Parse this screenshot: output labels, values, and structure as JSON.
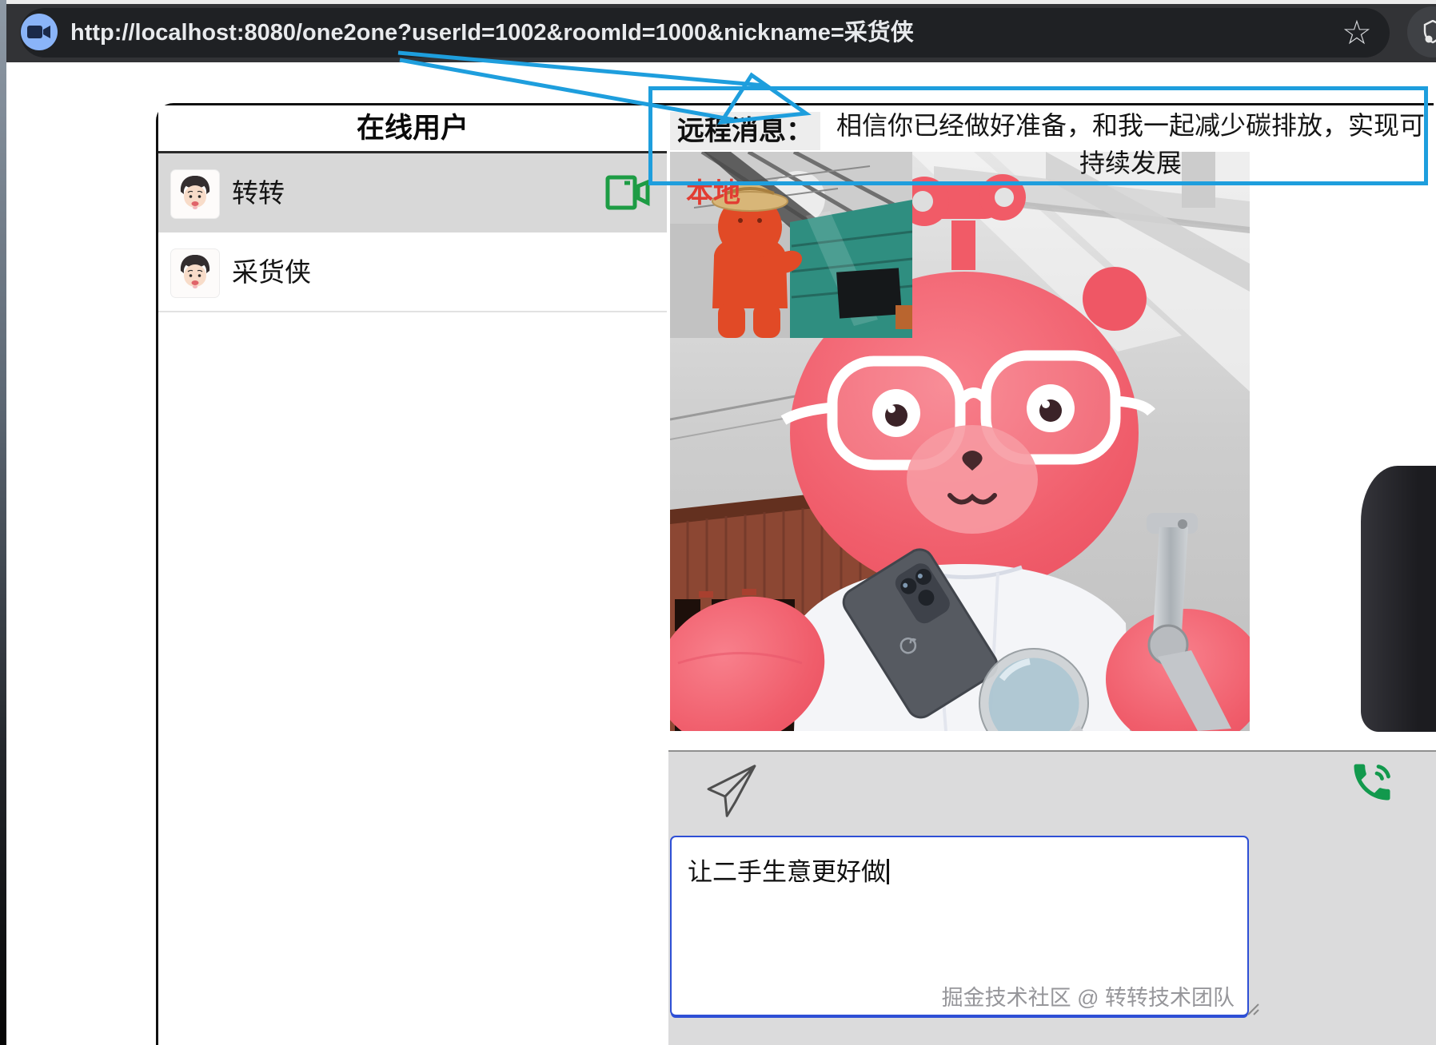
{
  "browser": {
    "url": "http://localhost:8080/one2one?userId=1002&roomId=1000&nickname=采货侠",
    "icons": {
      "camera_indicator": "video-camera-in-use",
      "bookmark": "star",
      "profile": "profile-circle"
    },
    "bookmark_glyph": "☆"
  },
  "online_users": {
    "title": "在线用户",
    "users": [
      {
        "name": "转转",
        "selected": true,
        "in_call": true
      },
      {
        "name": "采货侠",
        "selected": false,
        "in_call": false
      }
    ]
  },
  "remote_message": {
    "label": "远程消息：",
    "text": "相信你已经做好准备，和我一起减少碳排放，实现可持续发展"
  },
  "video": {
    "local_label": "本地"
  },
  "toolbar": {
    "send_icon": "paper-plane",
    "call_icon": "phone-call"
  },
  "composer": {
    "text": "让二手生意更好做",
    "watermark": "掘金技术社区 @ 转转技术团队"
  },
  "annotation": {
    "color": "#1e9edd",
    "shape": "arrow-from-url-to-remote-message-box"
  },
  "colors": {
    "accent_blue": "#1e9edd",
    "selected_row": "#d8d8d8",
    "call_green": "#12994d",
    "camera_green": "#1d9c44",
    "local_label_red": "#e23c32"
  }
}
